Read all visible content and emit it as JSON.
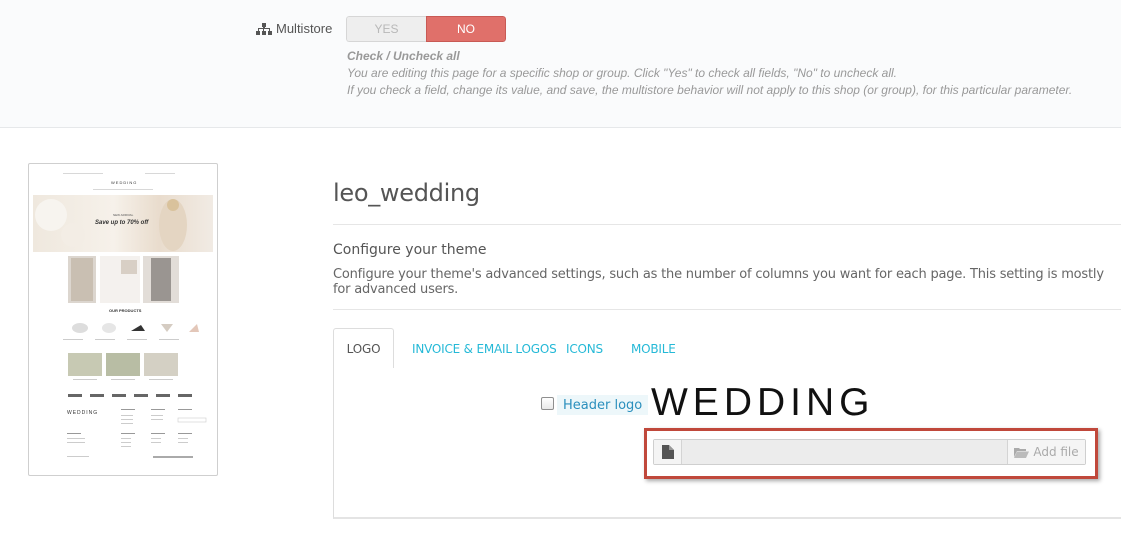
{
  "multistore": {
    "label": "Multistore",
    "icon": "sitemap-icon",
    "toggle": {
      "yes_label": "YES",
      "no_label": "NO",
      "selected": "NO"
    },
    "help": {
      "title": "Check / Uncheck all",
      "line1": "You are editing this page for a specific shop or group. Click \"Yes\" to check all fields, \"No\" to uncheck all.",
      "line2": "If you check a field, change its value, and save, the multistore behavior will not apply to this shop (or group), for this particular parameter."
    }
  },
  "thumbnail": {
    "hero_text": "Save up to 70% off",
    "hero_small": "NEW ARRIVAL",
    "logo": "WEDDING",
    "section_title": "OUR PRODUCTS",
    "footer_logo": "WEDDING"
  },
  "theme": {
    "name": "leo_wedding",
    "configure_heading": "Configure your theme",
    "configure_desc": "Configure your theme's advanced settings, such as the number of columns you want for each page. This setting is mostly for advanced users."
  },
  "tabs": [
    {
      "label": "LOGO",
      "active": true
    },
    {
      "label": "INVOICE & EMAIL LOGOS",
      "active": false
    },
    {
      "label": "ICONS",
      "active": false
    },
    {
      "label": "MOBILE",
      "active": false
    }
  ],
  "logo_panel": {
    "checkbox_label": "Header logo",
    "checked": false,
    "logo_text": "WEDDING",
    "file_icon": "file-icon",
    "add_file_icon": "folder-open-icon",
    "add_file_label": "Add file"
  },
  "colors": {
    "accent": "#25b9d7",
    "no_active": "#e0706a",
    "highlight_border": "#c0483b"
  }
}
